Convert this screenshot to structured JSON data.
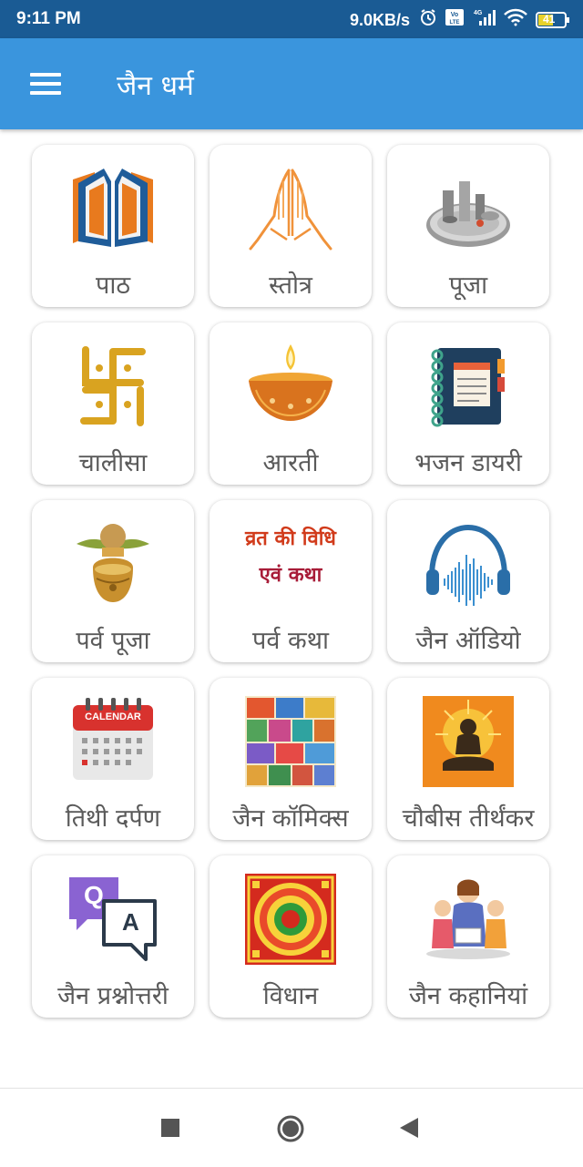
{
  "status_bar": {
    "time": "9:11 PM",
    "network_speed": "9.0KB/s",
    "battery_level": "41",
    "icons": [
      "alarm-icon",
      "volte-icon",
      "signal-icon",
      "wifi-icon",
      "battery-icon"
    ]
  },
  "app_bar": {
    "title": "जैन धर्म",
    "menu_icon": "hamburger-menu-icon"
  },
  "grid": {
    "items": [
      {
        "label": "पाठ",
        "icon": "open-book-icon"
      },
      {
        "label": "स्तोत्र",
        "icon": "folded-hands-icon"
      },
      {
        "label": "पूजा",
        "icon": "puja-thali-icon"
      },
      {
        "label": "चालीसा",
        "icon": "swastika-icon"
      },
      {
        "label": "आरती",
        "icon": "diya-lamp-icon"
      },
      {
        "label": "भजन डायरी",
        "icon": "notebook-icon"
      },
      {
        "label": "पर्व पूजा",
        "icon": "kalash-icon"
      },
      {
        "label": "पर्व कथा",
        "icon": "vrat-katha-text-icon",
        "icon_text": [
          "व्रत की विधि",
          "एवं कथा"
        ]
      },
      {
        "label": "जैन ऑडियो",
        "icon": "headphones-icon"
      },
      {
        "label": "तिथी दर्पण",
        "icon": "calendar-icon",
        "icon_text": "CALENDAR"
      },
      {
        "label": "जैन कॉमिक्स",
        "icon": "comics-collage-icon"
      },
      {
        "label": "चौबीस तीर्थंकर",
        "icon": "tirthankar-icon"
      },
      {
        "label": "जैन प्रश्नोत्तरी",
        "icon": "question-answer-icon",
        "icon_text": [
          "Q",
          "A"
        ]
      },
      {
        "label": "विधान",
        "icon": "mandala-icon"
      },
      {
        "label": "जैन कहानियां",
        "icon": "storytelling-icon"
      }
    ]
  },
  "nav_bar": {
    "buttons": [
      "recents-square-icon",
      "home-circle-icon",
      "back-triangle-icon"
    ]
  },
  "colors": {
    "status_bar": "#1a5b94",
    "app_bar": "#3a95dd",
    "tile_label": "#5a5a5a"
  }
}
